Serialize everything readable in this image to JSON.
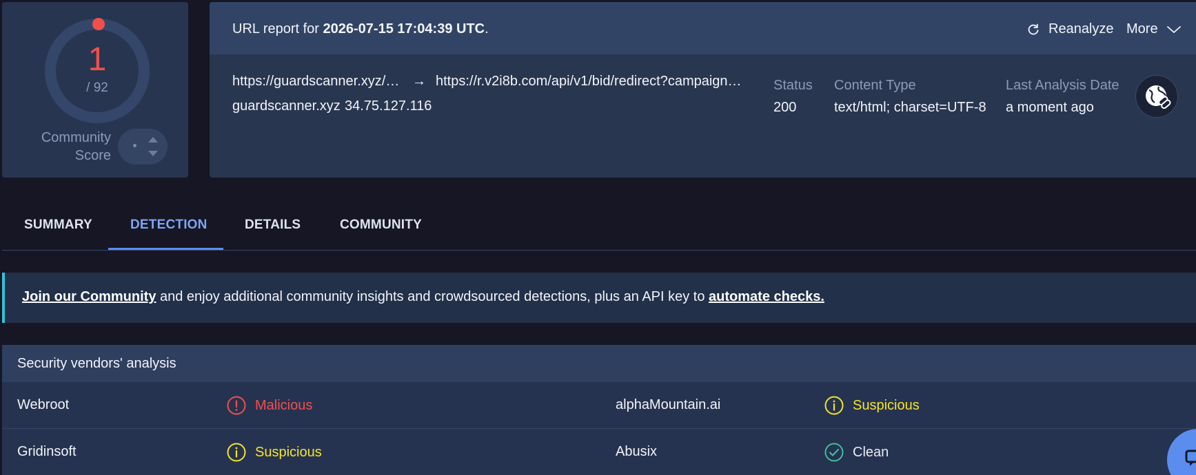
{
  "score": {
    "detections": "1",
    "total": "/ 92",
    "community_label": "Community Score",
    "accent_color": "#f0504c"
  },
  "report": {
    "title_prefix": "URL report for ",
    "title_date": "2026-07-15 17:04:39 UTC",
    "title_suffix": ".",
    "reanalyze_label": "Reanalyze",
    "more_label": "More",
    "source_url": "https://guardscanner.xyz/…",
    "arrow": "→",
    "final_url": "https://r.v2i8b.com/api/v1/bid/redirect?campaign…",
    "domain": "guardscanner.xyz",
    "ip": "34.75.127.116",
    "status_label": "Status",
    "status_value": "200",
    "content_type_label": "Content Type",
    "content_type_value": "text/html; charset=UTF-8",
    "last_analysis_label": "Last Analysis Date",
    "last_analysis_value": "a moment ago",
    "icons": [
      "reload-icon",
      "chevron-down-icon",
      "globe-link-icon"
    ]
  },
  "tabs": [
    {
      "label": "SUMMARY",
      "active": false
    },
    {
      "label": "DETECTION",
      "active": true
    },
    {
      "label": "DETAILS",
      "active": false
    },
    {
      "label": "COMMUNITY",
      "active": false
    }
  ],
  "banner": {
    "link1": "Join our Community",
    "middle": " and enjoy additional community insights and crowdsourced detections, plus an API key to ",
    "link2": "automate checks.",
    "accent_color": "#2ec6d9"
  },
  "vendors": {
    "title": "Security vendors' analysis",
    "rows": [
      [
        {
          "vendor": "Webroot",
          "result": "Malicious",
          "icon": "alert-circle-icon",
          "color": "#f0504c"
        },
        {
          "vendor": "alphaMountain.ai",
          "result": "Suspicious",
          "icon": "info-circle-icon",
          "color": "#f5e52a"
        }
      ],
      [
        {
          "vendor": "Gridinsoft",
          "result": "Suspicious",
          "icon": "info-circle-icon",
          "color": "#f5e52a"
        },
        {
          "vendor": "Abusix",
          "result": "Clean",
          "icon": "check-circle-icon",
          "color": "#3fbf9b"
        }
      ]
    ]
  }
}
